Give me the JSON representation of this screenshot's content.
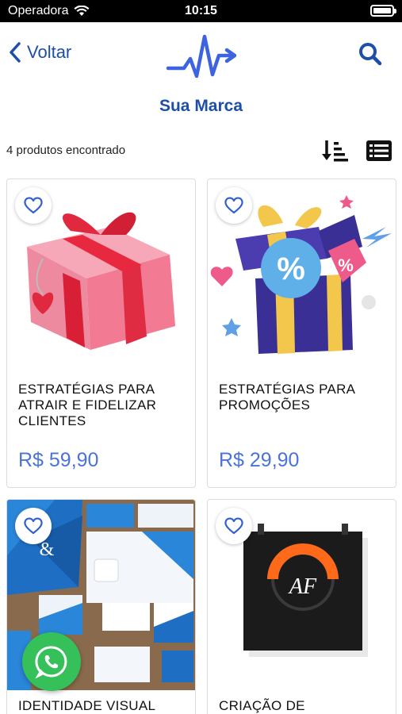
{
  "status_bar": {
    "carrier": "Operadora",
    "time": "10:15"
  },
  "nav": {
    "back_label": "Voltar"
  },
  "brand": {
    "title": "Sua Marca"
  },
  "toolbar": {
    "count_text": "4 produtos encontrado"
  },
  "colors": {
    "accent": "#1d4fa8",
    "price": "#4a73d9",
    "whatsapp": "#35c05a"
  },
  "products": [
    {
      "title": "ESTRATÉGIAS PARA ATRAIR E FIDELIZAR CLIENTES",
      "price": "R$  59,90",
      "image": "pink-gift-box"
    },
    {
      "title": "ESTRATÉGIAS PARA PROMOÇÕES",
      "price": "R$  29,90",
      "image": "purple-gift-box-percent"
    },
    {
      "title": "IDENTIDADE VISUAL",
      "price": "",
      "image": "stationery-mockup"
    },
    {
      "title": "CRIAÇÃO DE",
      "price": "",
      "image": "logo-poster"
    }
  ],
  "poster": {
    "logo_letters": "AF"
  },
  "icons": [
    "wifi-icon",
    "battery-icon",
    "chevron-left-icon",
    "search-icon",
    "sort-icon",
    "list-icon",
    "heart-icon",
    "whatsapp-icon"
  ]
}
